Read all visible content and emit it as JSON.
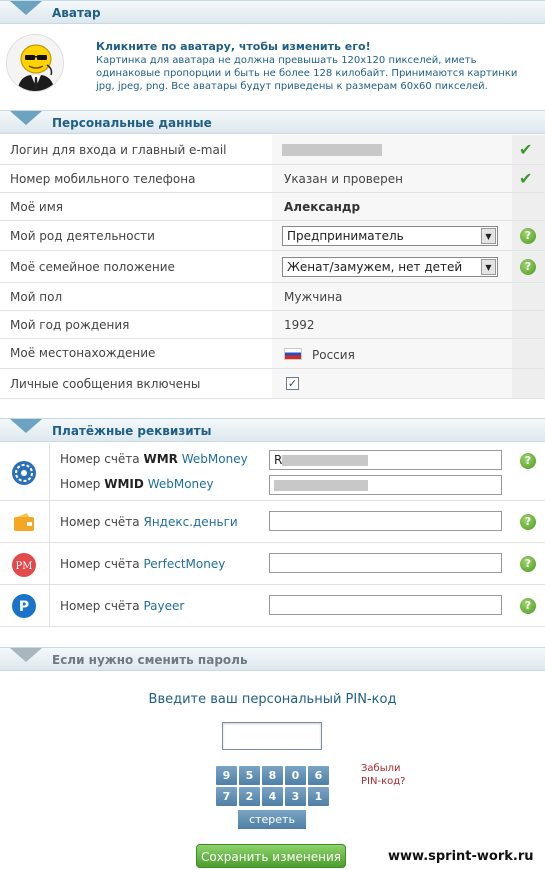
{
  "avatar": {
    "section_title": "Аватар",
    "heading": "Кликните по аватару, чтобы изменить его!",
    "description": "Картинка для аватара не должна превышать 120x120 пикселей, иметь одинаковые пропорции и быть не более 128 килобайт. Принимаются картинки jpg, jpeg, png. Все аватары будут приведены к размерам 60x60 пикселей."
  },
  "personal": {
    "section_title": "Персональные данные",
    "rows": [
      {
        "label": "Логин для входа и главный e-mail",
        "value": ""
      },
      {
        "label": "Номер мобильного телефона",
        "value": "Указан и проверен"
      },
      {
        "label": "Моё имя",
        "value": "Александр"
      },
      {
        "label": "Мой род деятельности",
        "value": "Предприниматель"
      },
      {
        "label": "Моё семейное положение",
        "value": "Женат/замужем, нет детей"
      },
      {
        "label": "Мой пол",
        "value": "Мужчина"
      },
      {
        "label": "Мой год рождения",
        "value": "1992"
      },
      {
        "label": "Моё местонахождение",
        "value": "Россия"
      },
      {
        "label": "Личные сообщения включены",
        "value": "✓"
      }
    ]
  },
  "payment": {
    "section_title": "Платёжные реквизиты",
    "wmr": {
      "prefix": "Номер счёта",
      "bold": "WMR",
      "link": "WebMoney",
      "value": "R"
    },
    "wmid": {
      "prefix": "Номер",
      "bold": "WMID",
      "link": "WebMoney",
      "value": ""
    },
    "yandex": {
      "prefix": "Номер счёта",
      "link": "Яндекс.деньги",
      "value": ""
    },
    "perfect": {
      "prefix": "Номер счёта",
      "link": "PerfectMoney",
      "value": ""
    },
    "payeer": {
      "prefix": "Номер счёта",
      "link": "Payeer",
      "value": ""
    }
  },
  "password": {
    "section_title": "Если нужно сменить пароль",
    "pin_title": "Введите ваш персональный PIN-код",
    "keys_row1": [
      "9",
      "5",
      "8",
      "0",
      "6"
    ],
    "keys_row2": [
      "7",
      "2",
      "4",
      "3",
      "1"
    ],
    "clear": "стереть",
    "forgot_line1": "Забыли",
    "forgot_line2": "PIN-код?"
  },
  "save_button": "Сохранить изменения",
  "site_label": "www.sprint-work.ru",
  "icons": {
    "ok": "check-icon",
    "help": "help-icon"
  },
  "colors": {
    "accent": "#1f5f86",
    "ok_green": "#3a9a2e",
    "keypad": "#5f8db3"
  }
}
